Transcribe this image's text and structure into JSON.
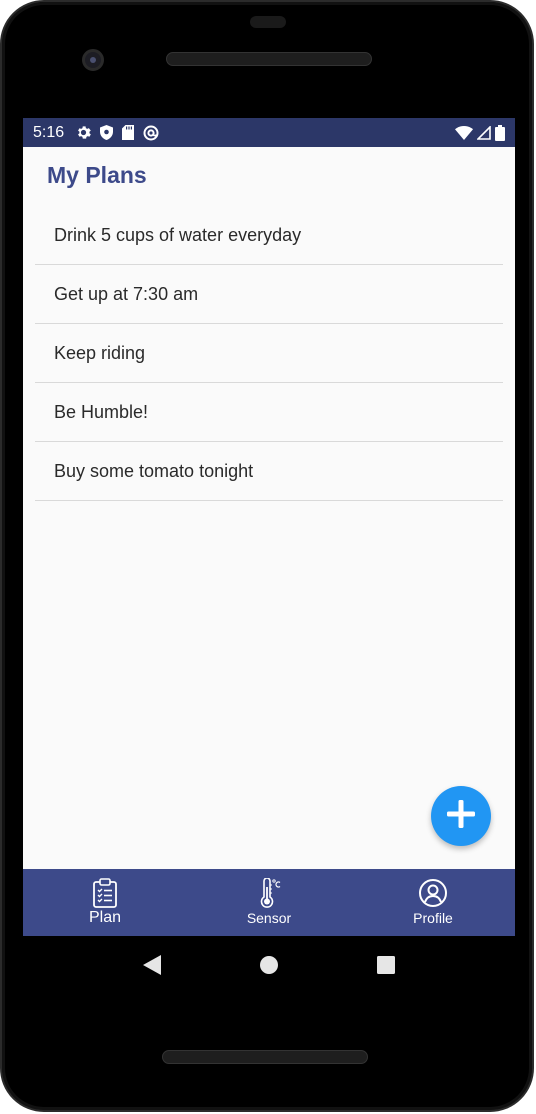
{
  "status_bar": {
    "time": "5:16",
    "left_icons": [
      "settings-gear-icon",
      "shield-icon",
      "sd-card-icon",
      "at-sign-icon"
    ],
    "right_icons": [
      "wifi-icon",
      "signal-icon",
      "battery-icon"
    ],
    "background_color": "#2c3768"
  },
  "page": {
    "title": "My Plans",
    "title_color": "#3d4a8a"
  },
  "plans": [
    "Drink 5 cups of water everyday",
    "Get up at 7:30 am",
    "Keep riding",
    "Be Humble!",
    "Buy some tomato tonight"
  ],
  "fab": {
    "icon": "plus-icon",
    "color": "#2196f3"
  },
  "bottom_nav": {
    "background_color": "#3d4a8a",
    "items": [
      {
        "label": "Plan",
        "icon": "clipboard-list-icon",
        "active": true
      },
      {
        "label": "Sensor",
        "icon": "thermometer-icon",
        "active": false
      },
      {
        "label": "Profile",
        "icon": "user-circle-icon",
        "active": false
      }
    ]
  },
  "system_nav": {
    "icons": [
      "back-triangle-icon",
      "home-circle-icon",
      "recents-square-icon"
    ]
  }
}
